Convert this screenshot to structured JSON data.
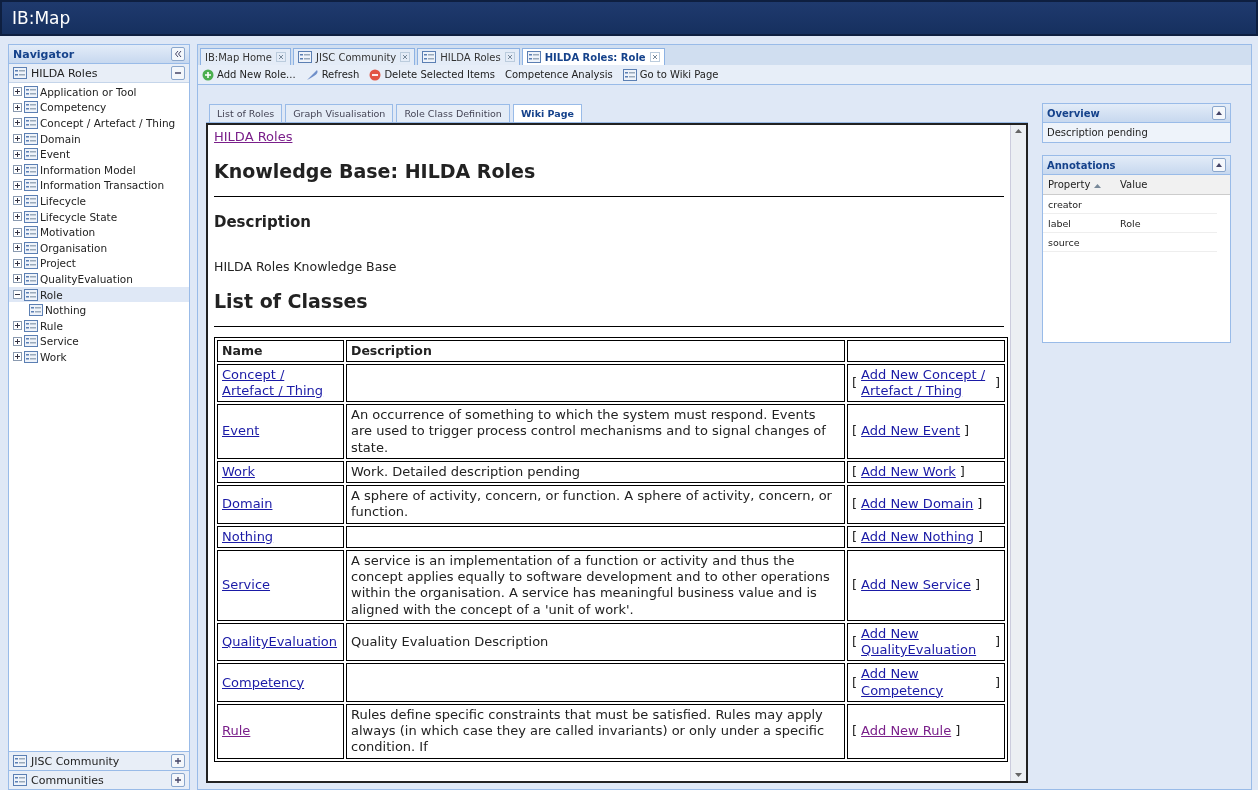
{
  "window": {
    "title": "IB:Map"
  },
  "navigator": {
    "title": "Navigator",
    "section": "HILDA Roles",
    "tree": [
      {
        "label": "Application or Tool",
        "expanded": false,
        "selected": false
      },
      {
        "label": "Competency",
        "expanded": false,
        "selected": false
      },
      {
        "label": "Concept / Artefact / Thing",
        "expanded": false,
        "selected": false
      },
      {
        "label": "Domain",
        "expanded": false,
        "selected": false
      },
      {
        "label": "Event",
        "expanded": false,
        "selected": false
      },
      {
        "label": "Information Model",
        "expanded": false,
        "selected": false
      },
      {
        "label": "Information Transaction",
        "expanded": false,
        "selected": false
      },
      {
        "label": "Lifecycle",
        "expanded": false,
        "selected": false
      },
      {
        "label": "Lifecycle State",
        "expanded": false,
        "selected": false
      },
      {
        "label": "Motivation",
        "expanded": false,
        "selected": false
      },
      {
        "label": "Organisation",
        "expanded": false,
        "selected": false
      },
      {
        "label": "Project",
        "expanded": false,
        "selected": false
      },
      {
        "label": "QualityEvaluation",
        "expanded": false,
        "selected": false
      },
      {
        "label": "Role",
        "expanded": true,
        "selected": true,
        "children": [
          {
            "label": "Nothing",
            "selected": false
          }
        ]
      },
      {
        "label": "Rule",
        "expanded": false,
        "selected": false
      },
      {
        "label": "Service",
        "expanded": false,
        "selected": false
      },
      {
        "label": "Work",
        "expanded": false,
        "selected": false
      }
    ],
    "bottom_sections": [
      "JISC Community",
      "Communities"
    ]
  },
  "tabs": [
    {
      "label": "IB:Map Home",
      "kind": "home",
      "selected": false
    },
    {
      "label": "JISC Community",
      "kind": "page",
      "selected": false
    },
    {
      "label": "HILDA Roles",
      "kind": "page",
      "selected": false
    },
    {
      "label": "HILDA Roles: Role",
      "kind": "page",
      "selected": true
    }
  ],
  "toolbar": [
    {
      "label": "Add New Role...",
      "kind": "add"
    },
    {
      "label": "Refresh",
      "kind": "refresh"
    },
    {
      "label": "Delete Selected Items",
      "kind": "delete"
    },
    {
      "label": "Competence Analysis",
      "kind": "plain"
    },
    {
      "label": "Go to Wiki Page",
      "kind": "page"
    }
  ],
  "view_tabs": [
    {
      "label": "List of Roles",
      "selected": false
    },
    {
      "label": "Graph Visualisation",
      "selected": false
    },
    {
      "label": "Role Class Definition",
      "selected": false
    },
    {
      "label": "Wiki Page",
      "selected": true
    }
  ],
  "wiki": {
    "breadcrumb": {
      "label": "HILDA Roles",
      "visited": true
    },
    "heading": "Knowledge Base: HILDA Roles",
    "description_heading": "Description",
    "description": "HILDA Roles Knowledge Base",
    "classes_heading": "List of Classes",
    "table": {
      "columns": [
        "Name",
        "Description"
      ],
      "rows": [
        {
          "name": "Concept / Artefact / Thing",
          "visited": false,
          "action": {
            "before": "[",
            "label": "Add New Concept / Artefact / Thing",
            "after": "]",
            "visited": false
          }
        },
        {
          "name": "Event",
          "visited": false,
          "description": "An occurrence of something to which the system must respond. Events are used to trigger process control mechanisms and to signal changes of state.",
          "action": {
            "before": "[",
            "label": "Add New Event",
            "after": "]",
            "visited": false
          }
        },
        {
          "name": "Work",
          "visited": false,
          "description": "Work. Detailed description pending",
          "action": {
            "before": "[",
            "label": "Add New Work",
            "after": "]",
            "visited": false
          }
        },
        {
          "name": "Domain",
          "visited": false,
          "description": "A sphere of activity, concern, or function. A sphere of activity, concern, or function.",
          "action": {
            "before": "[",
            "label": "Add New Domain",
            "after": "]",
            "visited": false
          }
        },
        {
          "name": "Nothing",
          "visited": false,
          "action": {
            "before": "[",
            "label": "Add New Nothing",
            "after": "]",
            "visited": false
          }
        },
        {
          "name": "Service",
          "visited": false,
          "description": "A service is an implementation of a function or activity and thus the concept applies equally to software development and to other operations within the organisation. A service has meaningful business value and is aligned with the concept of a 'unit of work'.",
          "action": {
            "before": "[",
            "label": "Add New Service",
            "after": "]",
            "visited": false
          }
        },
        {
          "name": "QualityEvaluation",
          "visited": false,
          "description": "Quality Evaluation Description",
          "action": {
            "before": "[",
            "label": "Add New QualityEvaluation",
            "after": "]",
            "visited": false
          }
        },
        {
          "name": "Competency",
          "visited": false,
          "action": {
            "before": "[",
            "label": "Add New Competency",
            "after": "]",
            "visited": false
          }
        },
        {
          "name": "Rule",
          "visited": true,
          "description": "Rules define specific constraints that must be satisfied. Rules may apply always (in which case they are called invariants) or only under a specific condition. If",
          "action": {
            "before": "[",
            "label": "Add New Rule",
            "after": "]",
            "visited": true
          }
        }
      ]
    }
  },
  "overview": {
    "title": "Overview",
    "text": "Description pending"
  },
  "annotations": {
    "title": "Annotations",
    "columns": [
      {
        "label": "Property",
        "sorted": true
      },
      {
        "label": "Value",
        "sorted": false
      }
    ],
    "rows": [
      {
        "property": "creator"
      },
      {
        "property": "label",
        "value": "Role"
      },
      {
        "property": "source"
      }
    ]
  }
}
